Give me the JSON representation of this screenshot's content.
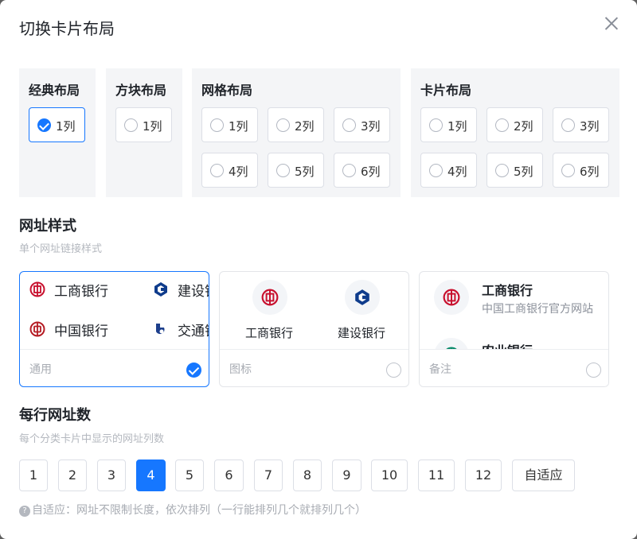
{
  "dialog": {
    "title": "切换卡片布局"
  },
  "layouts": {
    "classic": {
      "title": "经典布局",
      "options": [
        "1列"
      ]
    },
    "block": {
      "title": "方块布局",
      "options": [
        "1列"
      ]
    },
    "grid": {
      "title": "网格布局",
      "options": [
        "1列",
        "2列",
        "3列",
        "4列",
        "5列",
        "6列"
      ]
    },
    "card": {
      "title": "卡片布局",
      "options": [
        "1列",
        "2列",
        "3列",
        "4列",
        "5列",
        "6列"
      ]
    },
    "selected": "classic-1列"
  },
  "url_style": {
    "title": "网址样式",
    "desc": "单个网址链接样式",
    "cards": [
      {
        "label": "通用",
        "selected": true,
        "items": [
          "工商银行",
          "建设银行",
          "中国银行",
          "交通银行"
        ]
      },
      {
        "label": "图标",
        "selected": false,
        "items": [
          "工商银行",
          "建设银行"
        ]
      },
      {
        "label": "备注",
        "selected": false,
        "items": [
          {
            "name": "工商银行",
            "note": "中国工商银行官方网站"
          },
          {
            "name": "农业银行"
          }
        ]
      }
    ]
  },
  "per_row": {
    "title": "每行网址数",
    "desc": "每个分类卡片中显示的网址列数",
    "options": [
      "1",
      "2",
      "3",
      "4",
      "5",
      "6",
      "7",
      "8",
      "9",
      "10",
      "11",
      "12",
      "自适应"
    ],
    "selected": "4",
    "hint": "自适应：网址不限制长度，依次排列（一行能排列几个就排列几个）"
  },
  "colors": {
    "primary": "#1677ff",
    "icbc": "#c8102e",
    "ccb": "#0f3c8c",
    "boc": "#b51c24",
    "bocom": "#1d3f8c",
    "abc": "#0a8a6a"
  }
}
